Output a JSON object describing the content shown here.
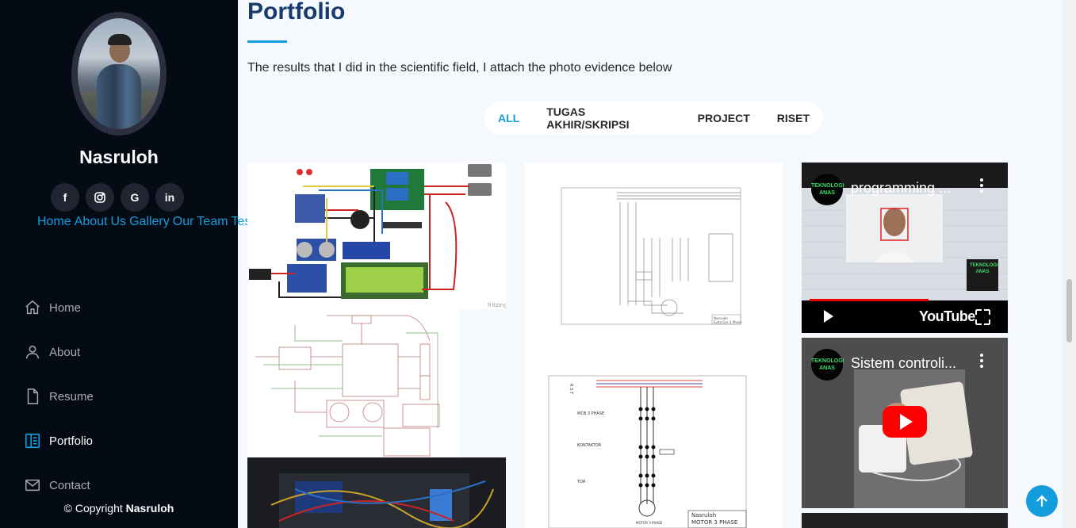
{
  "profile": {
    "name": "Nasruloh"
  },
  "socials": [
    {
      "icon": "facebook-icon",
      "glyph": "f"
    },
    {
      "icon": "instagram-icon",
      "glyph": ""
    },
    {
      "icon": "google-icon",
      "glyph": "G"
    },
    {
      "icon": "linkedin-icon",
      "glyph": "in"
    }
  ],
  "quicklinks": [
    "Home",
    "About",
    "Us",
    "Gallery",
    "Our",
    "Team",
    "Testimony"
  ],
  "nav": [
    {
      "label": "Home",
      "icon": "home-icon"
    },
    {
      "label": "About",
      "icon": "person-icon"
    },
    {
      "label": "Resume",
      "icon": "file-icon"
    },
    {
      "label": "Portfolio",
      "icon": "portfolio-icon",
      "active": true
    },
    {
      "label": "Contact",
      "icon": "envelope-icon"
    }
  ],
  "copyright": {
    "prefix": "© Copyright",
    "owner": "Nasruloh"
  },
  "section": {
    "title": "Portfolio",
    "description": "The results that I did in the scientific field, I attach the photo evidence below"
  },
  "filters": [
    {
      "label": "ALL",
      "active": true
    },
    {
      "label": "TUGAS AKHIR/SKRIPSI"
    },
    {
      "label": "PROJECT"
    },
    {
      "label": "RISET"
    }
  ],
  "images": {
    "fritzing": "fritzing",
    "circuit1": {
      "line1": "Nasruloh",
      "line2": "Evita Ger 3 Phase"
    },
    "circuit2": {
      "rst": "R S T",
      "mcb": "MCB 3 PHASE",
      "kontaktor": "KONTAKTOR",
      "tor": "TOR",
      "motor": "MOTOR 3 PHASE",
      "line1": "Nasruloh",
      "line2": "MOTOR 3 PHASE"
    }
  },
  "videos": [
    {
      "title": "programming ...",
      "channel": "TEKNOLOGI ANAS",
      "brand": "YouTube"
    },
    {
      "title": "Sistem controli...",
      "channel": "TEKNOLOGI ANAS"
    }
  ],
  "colors": {
    "accent": "#149ddd",
    "sidebar": "#040b14",
    "title": "#173b6c"
  }
}
